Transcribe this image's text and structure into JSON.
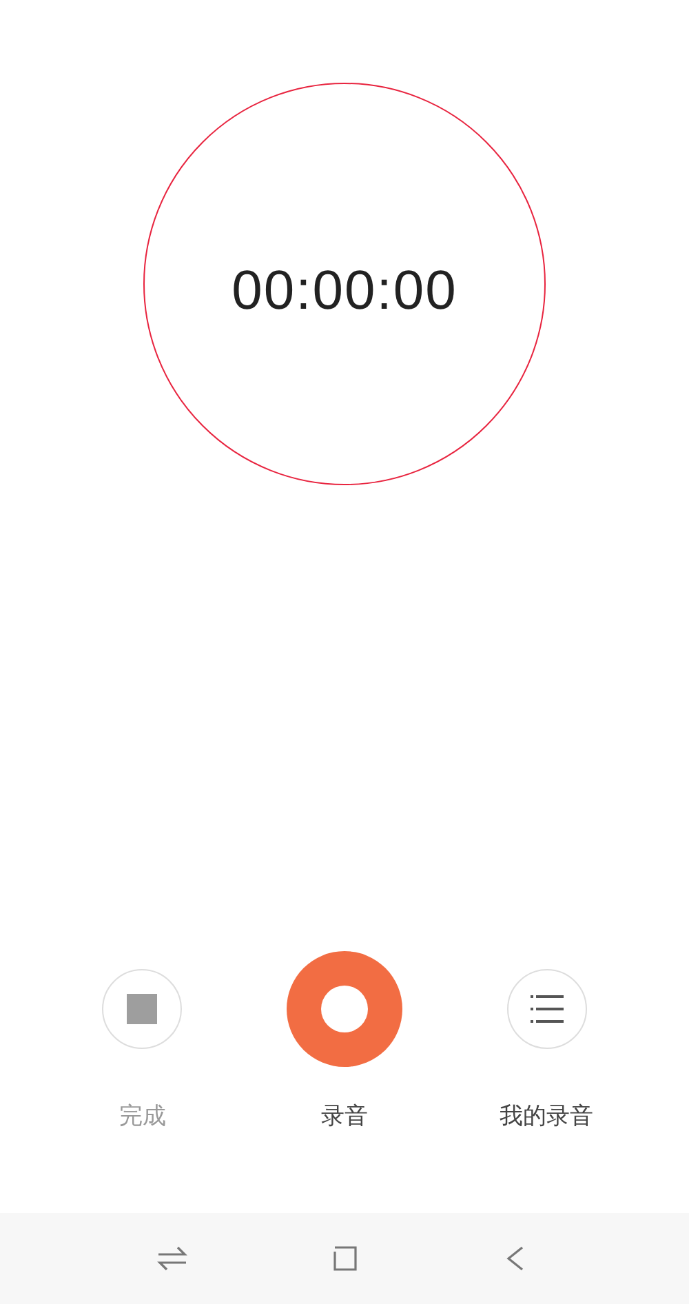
{
  "timer": {
    "text": "00:00:00"
  },
  "controls": [
    {
      "kind": "stop",
      "label": "完成"
    },
    {
      "kind": "record",
      "label": "录音"
    },
    {
      "kind": "list",
      "label": "我的录音"
    }
  ],
  "nav_bar": [
    {
      "kind": "switch"
    },
    {
      "kind": "home"
    },
    {
      "kind": "back"
    }
  ]
}
